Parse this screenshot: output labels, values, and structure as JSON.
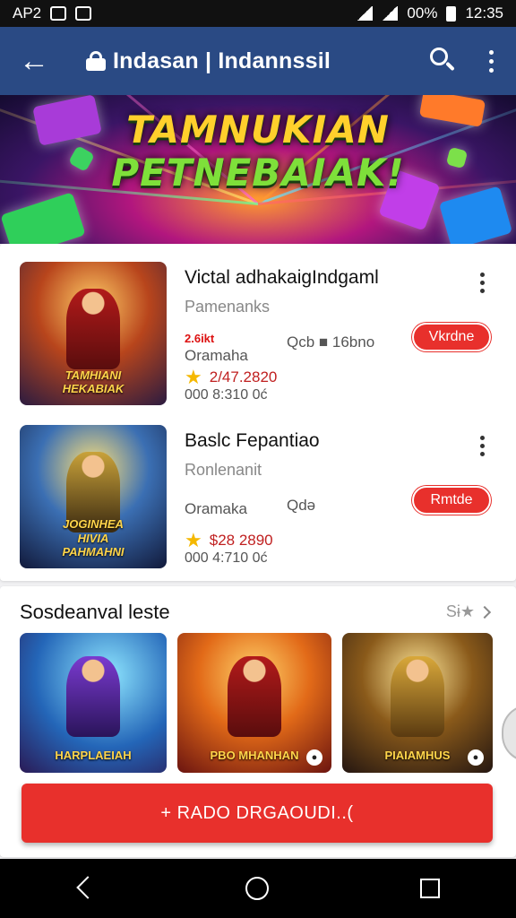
{
  "status_bar": {
    "left_text": "AP2",
    "right_text": "00%",
    "time": "12:35"
  },
  "app_bar": {
    "title": "Indasan | Indannssil"
  },
  "banner": {
    "line1": "TAMNUKIAN",
    "line2": "PETNEBAIAK!"
  },
  "apps": [
    {
      "name": "Victal adhakaigIndgaml",
      "developer": "Pamenanks",
      "tag": "2.6ikt",
      "category": "Oramaha",
      "extra": "Qcb ■ 16bno",
      "rating": "2/47.2820",
      "downloads": "000 8:310 0ć",
      "thumb_label": "TAMHIANI\nHEKABIAK",
      "button": "Vkrdne"
    },
    {
      "name": "Baslc Fepantiao",
      "developer": "Ronlenanit",
      "tag": "",
      "category": "Oramaka",
      "extra": "Qdə",
      "rating": "$28 2890",
      "downloads": "000 4:710 0ć",
      "thumb_label": "JOGINHEA\nHIVIA\nPAHMAHNI",
      "button": "Rmtde"
    }
  ],
  "section": {
    "title": "Sosdeanval leste",
    "see_all": "Sɨ★"
  },
  "tiles": [
    {
      "label": "HARPLAEIAH"
    },
    {
      "label": "PBO MHANHAN",
      "badge": "●"
    },
    {
      "label": "PIAIAMHUS",
      "badge": "●"
    }
  ],
  "primary_button": "+ RADO DRGAOUDI..(",
  "colors": {
    "app_bar": "#2a4a84",
    "accent": "#e8302c",
    "status_bar": "#111111"
  }
}
